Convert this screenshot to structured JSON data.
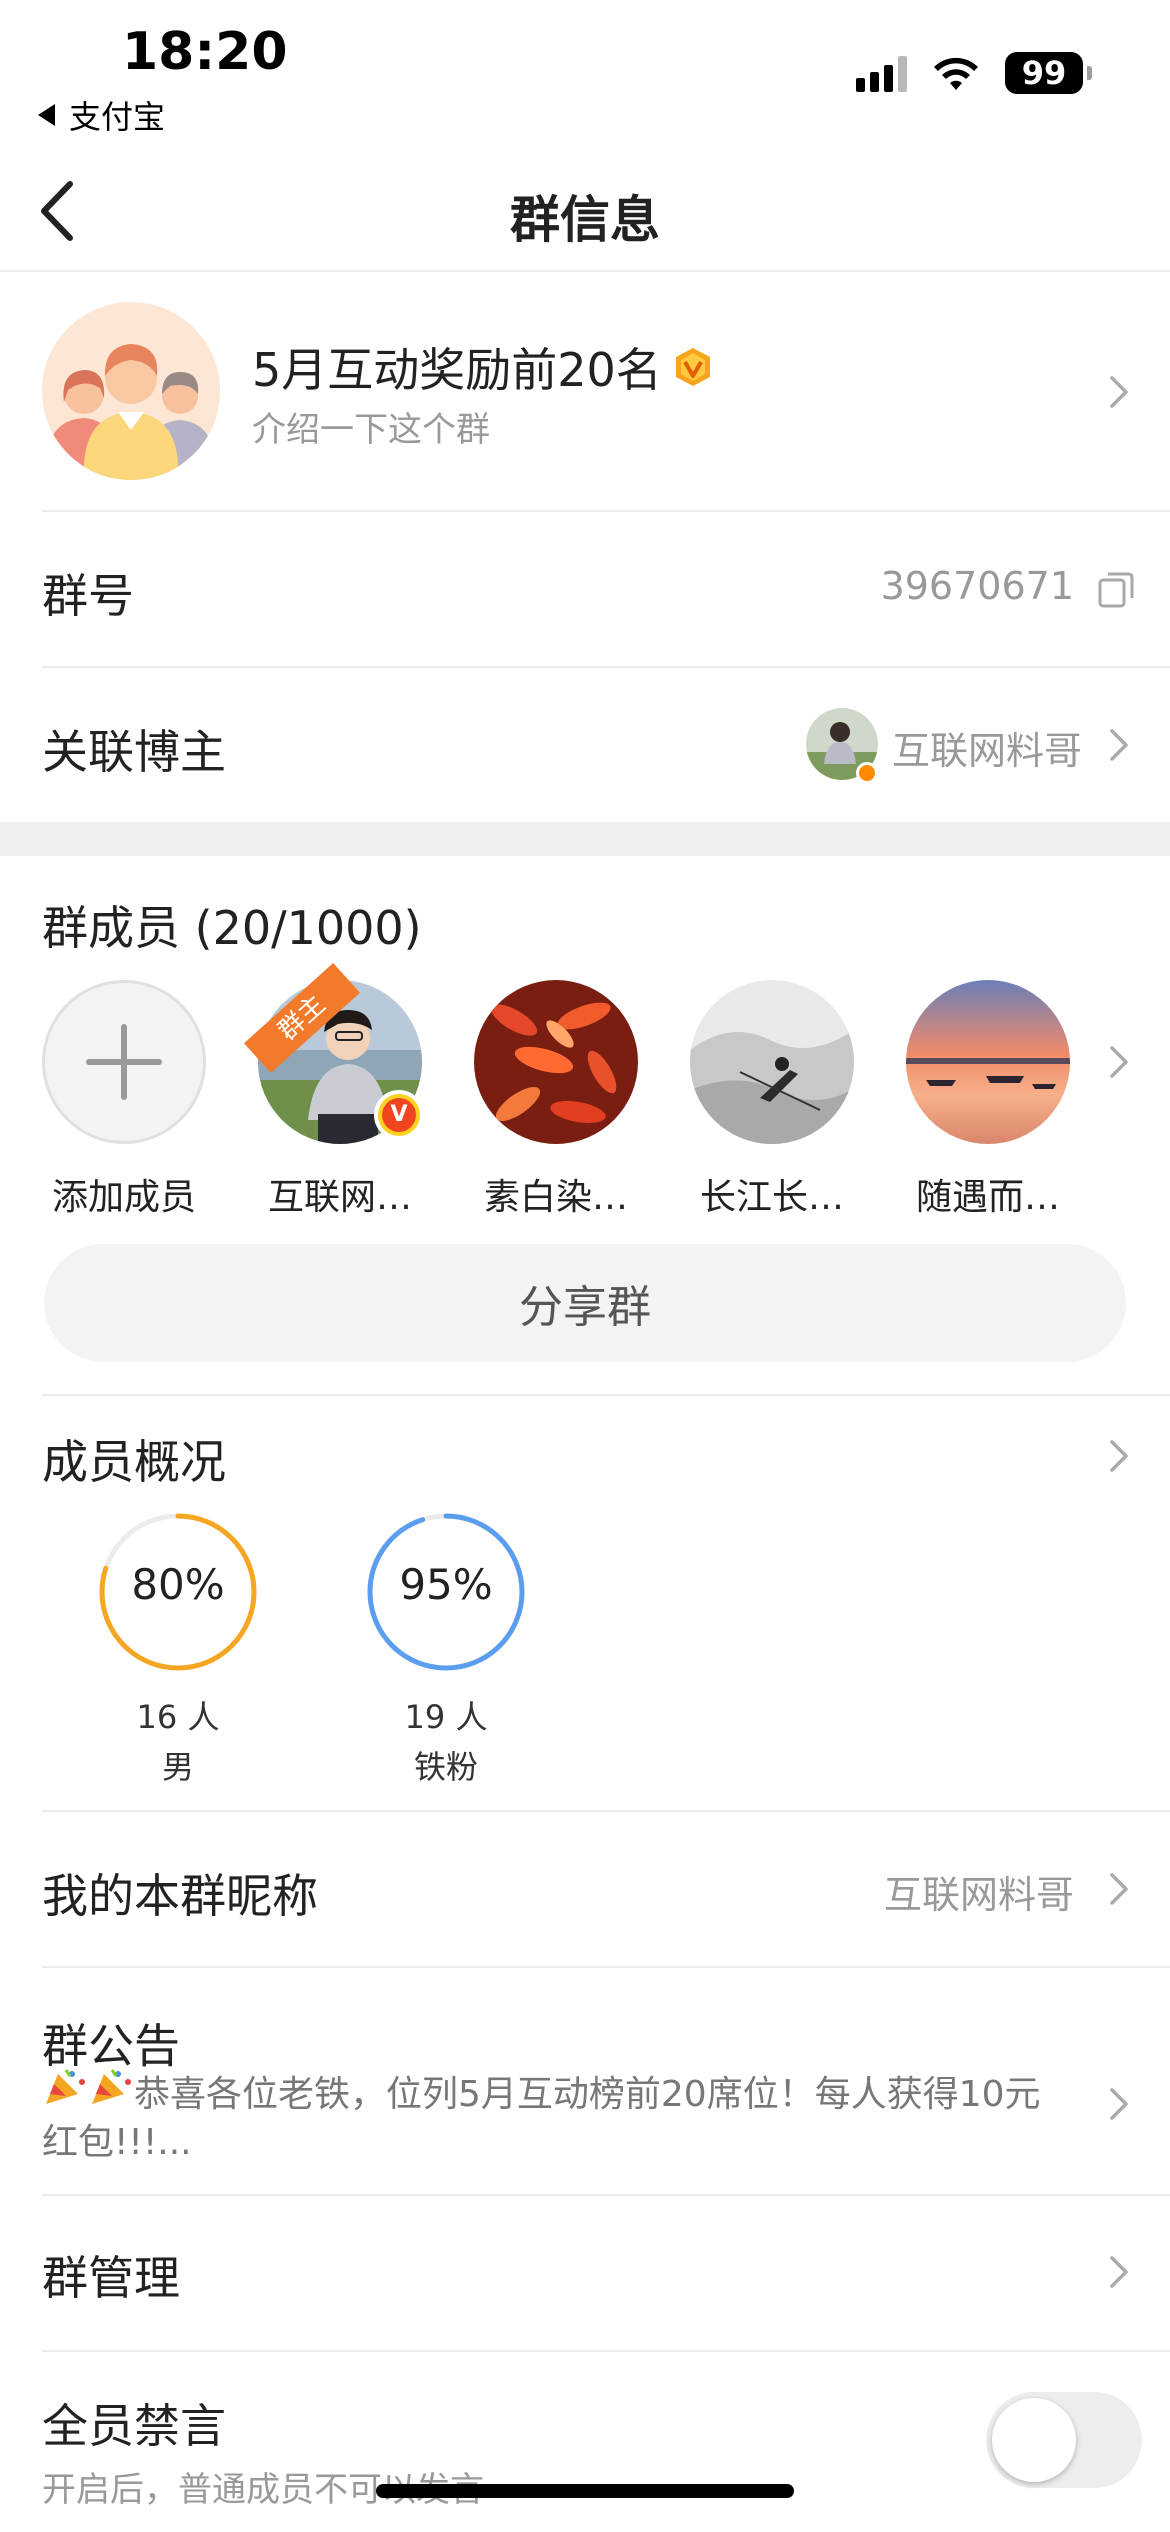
{
  "status_bar": {
    "time": "18:20",
    "back_app": "支付宝",
    "battery": "99"
  },
  "nav": {
    "title": "群信息"
  },
  "group": {
    "name": "5月互动奖励前20名",
    "intro": "介绍一下这个群"
  },
  "group_number": {
    "label": "群号",
    "value": "39670671"
  },
  "linked_blogger": {
    "label": "关联博主",
    "name": "互联网料哥"
  },
  "members": {
    "title": "群成员 (20/1000)",
    "owner_tag": "群主",
    "items": [
      {
        "name": "添加成员"
      },
      {
        "name": "互联网…"
      },
      {
        "name": "素白染…"
      },
      {
        "name": "长江长…"
      },
      {
        "name": "随遇而…"
      }
    ],
    "share_label": "分享群"
  },
  "overview": {
    "title": "成员概况",
    "stats": [
      {
        "percent": "80%",
        "value": 0.8,
        "count": "16 人",
        "kind": "男",
        "color": "#f5a623"
      },
      {
        "percent": "95%",
        "value": 0.95,
        "count": "19 人",
        "kind": "铁粉",
        "color": "#5b9ef0"
      }
    ]
  },
  "nickname": {
    "label": "我的本群昵称",
    "value": "互联网料哥"
  },
  "notice": {
    "label": "群公告",
    "text": "恭喜各位老铁，位列5月互动榜前20席位！每人获得10元红包!!!..."
  },
  "manage": {
    "label": "群管理"
  },
  "mute_all": {
    "label": "全员禁言",
    "desc": "开启后，普通成员不可以发言",
    "enabled": false
  }
}
